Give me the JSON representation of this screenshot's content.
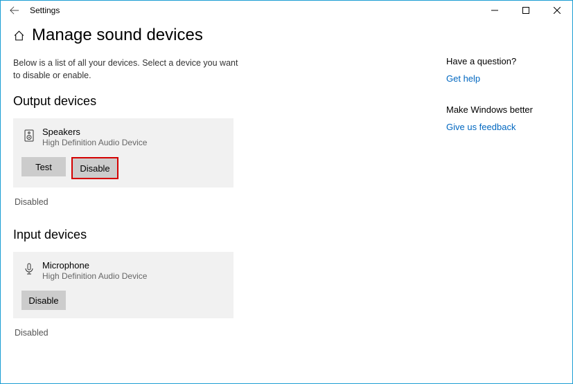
{
  "app_title": "Settings",
  "page_title": "Manage sound devices",
  "intro": "Below is a list of all your devices. Select a device you want to disable or enable.",
  "output": {
    "section_title": "Output devices",
    "device_name": "Speakers",
    "device_sub": "High Definition Audio Device",
    "test_label": "Test",
    "disable_label": "Disable",
    "status": "Disabled"
  },
  "input": {
    "section_title": "Input devices",
    "device_name": "Microphone",
    "device_sub": "High Definition Audio Device",
    "disable_label": "Disable",
    "status": "Disabled"
  },
  "sidebar": {
    "question_heading": "Have a question?",
    "help_link": "Get help",
    "better_heading": "Make Windows better",
    "feedback_link": "Give us feedback"
  }
}
